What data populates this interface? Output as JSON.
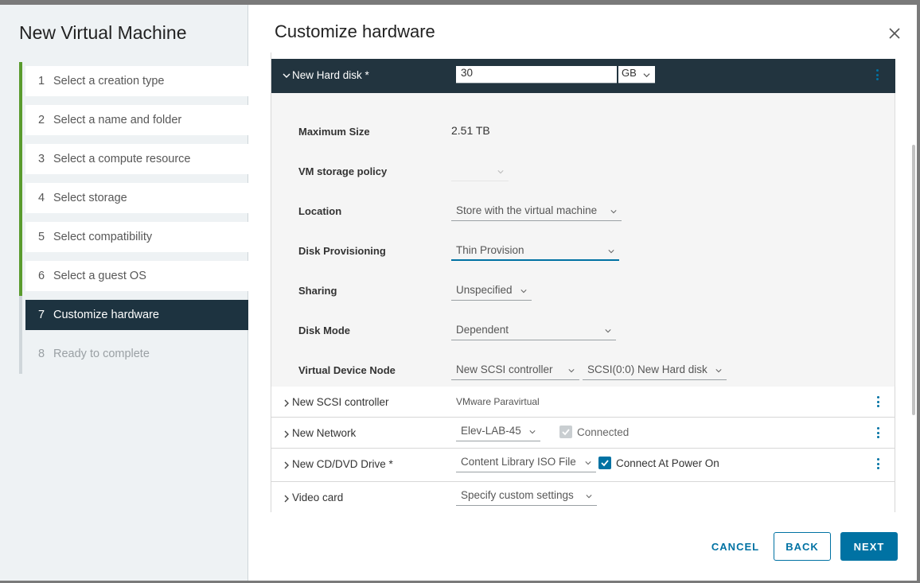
{
  "wizard": {
    "title": "New Virtual Machine",
    "steps": [
      {
        "num": "1",
        "label": "Select a creation type"
      },
      {
        "num": "2",
        "label": "Select a name and folder"
      },
      {
        "num": "3",
        "label": "Select a compute resource"
      },
      {
        "num": "4",
        "label": "Select storage"
      },
      {
        "num": "5",
        "label": "Select compatibility"
      },
      {
        "num": "6",
        "label": "Select a guest OS"
      },
      {
        "num": "7",
        "label": "Customize hardware"
      },
      {
        "num": "8",
        "label": "Ready to complete"
      }
    ],
    "active_step": 7
  },
  "page": {
    "title": "Customize hardware"
  },
  "hard_disk": {
    "label": "New Hard disk *",
    "size_value": "30",
    "size_unit": "GB",
    "props": {
      "max_size_label": "Maximum Size",
      "max_size_value": "2.51 TB",
      "storage_policy_label": "VM storage policy",
      "storage_policy_value": "",
      "location_label": "Location",
      "location_value": "Store with the virtual machine",
      "provisioning_label": "Disk Provisioning",
      "provisioning_value": "Thin Provision",
      "sharing_label": "Sharing",
      "sharing_value": "Unspecified",
      "disk_mode_label": "Disk Mode",
      "disk_mode_value": "Dependent",
      "vdn_label": "Virtual Device Node",
      "vdn_controller": "New SCSI controller",
      "vdn_disk": "SCSI(0:0) New Hard disk"
    }
  },
  "hardware_rows": {
    "scsi": {
      "label": "New SCSI controller",
      "value": "VMware Paravirtual"
    },
    "network": {
      "label": "New Network",
      "value": "Elev-LAB-45",
      "checkbox_label": "Connected"
    },
    "cdrom": {
      "label": "New CD/DVD Drive *",
      "value": "Content Library ISO File",
      "checkbox_label": "Connect At Power On"
    },
    "video": {
      "label": "Video card",
      "value": "Specify custom settings"
    }
  },
  "footer": {
    "cancel": "CANCEL",
    "back": "BACK",
    "next": "NEXT"
  },
  "colors": {
    "accent": "#0072a3",
    "active_step_bg": "#1d3340",
    "header_bg": "#22343f",
    "completed_step_bar": "#5a9b2e"
  }
}
